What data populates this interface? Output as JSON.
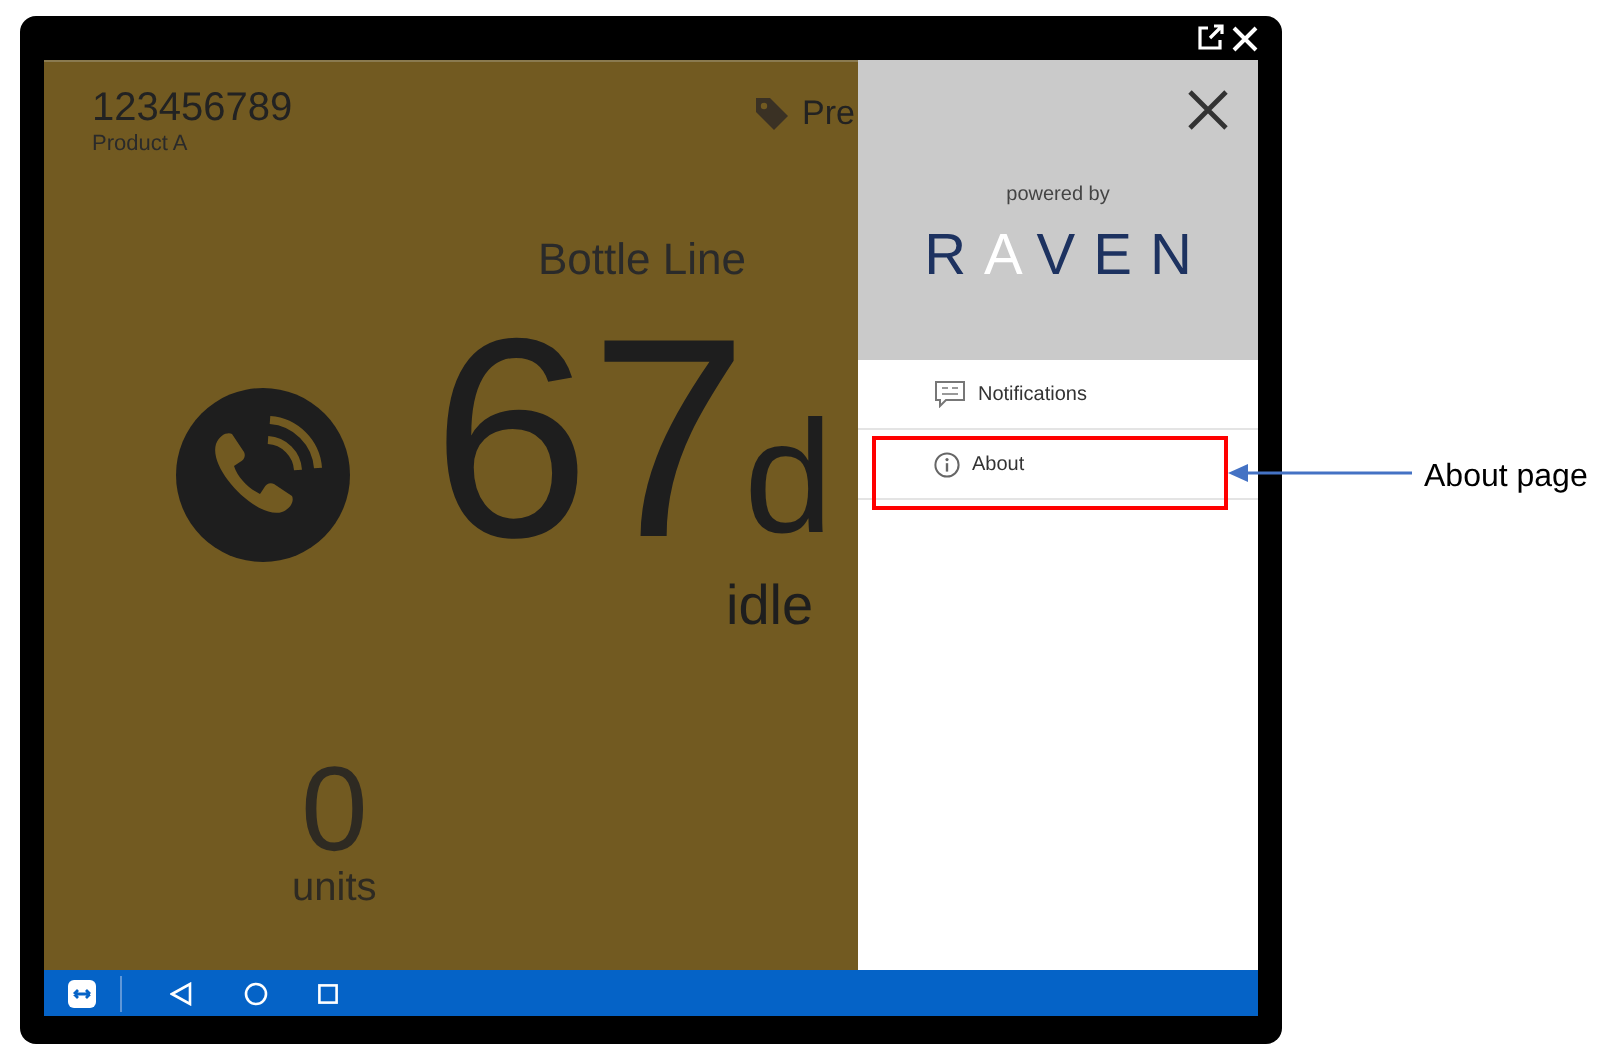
{
  "device": {
    "id": "123456789",
    "product": "Product A",
    "tag_label": "Pre",
    "line": "Bottle Line",
    "duration": "67",
    "duration_unit": "d",
    "status": "idle",
    "count": "0",
    "count_unit": "units"
  },
  "drawer": {
    "powered_by": "powered by",
    "logo": "RAVEN",
    "items": [
      {
        "label": "Notifications",
        "kind": "notifications",
        "highlighted": false
      },
      {
        "label": "About",
        "kind": "about",
        "highlighted": true
      }
    ]
  },
  "annotation": {
    "label": "About page"
  }
}
